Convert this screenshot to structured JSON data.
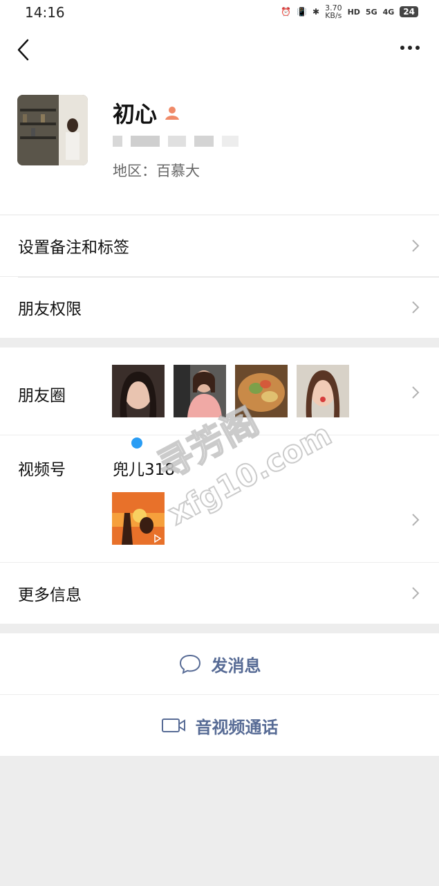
{
  "status_bar": {
    "time": "14:16",
    "net_speed_value": "3.70",
    "net_speed_unit": "KB/s",
    "hd_label": "HD",
    "signal_5g": "5G",
    "signal_4g": "4G",
    "battery": "24"
  },
  "profile": {
    "name": "初心",
    "region": "地区：百慕大"
  },
  "menu_top": [
    {
      "label": "设置备注和标签"
    },
    {
      "label": "朋友权限"
    }
  ],
  "moments": {
    "label": "朋友圈"
  },
  "channels": {
    "label": "视频号",
    "channel_name": "兜儿318"
  },
  "more_info": {
    "label": "更多信息"
  },
  "actions": {
    "message_label": "发消息",
    "call_label": "音视频通话"
  },
  "watermark": {
    "line1": "寻芳阁",
    "line2": "xfg10.com"
  },
  "colors": {
    "link_blue": "#576b95",
    "background_gray": "#ededed"
  }
}
